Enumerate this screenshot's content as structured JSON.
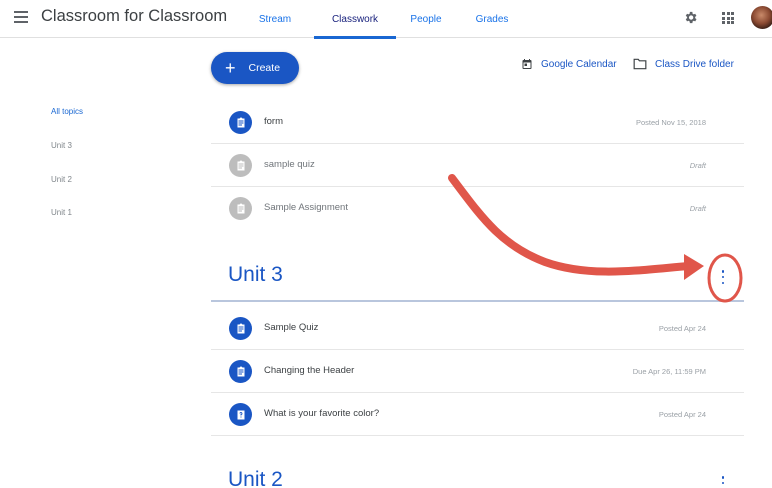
{
  "header": {
    "app_title": "Classroom for Classroom",
    "tabs": [
      {
        "label": "Stream"
      },
      {
        "label": "Classwork"
      },
      {
        "label": "People"
      },
      {
        "label": "Grades"
      }
    ],
    "active_tab": "Classwork",
    "icons": [
      "menu-icon",
      "gear-icon",
      "apps-grid-icon",
      "avatar"
    ]
  },
  "toolbar": {
    "create_label": "Create",
    "calendar_label": "Google Calendar",
    "drive_label": "Class Drive folder"
  },
  "sidebar": {
    "topics": [
      {
        "label": "All topics"
      },
      {
        "label": "Unit 3"
      },
      {
        "label": "Unit 2"
      },
      {
        "label": "Unit 1"
      }
    ]
  },
  "items": [
    {
      "title": "form",
      "meta": "Posted Nov 15, 2018",
      "icon": "assignment-icon"
    },
    {
      "title": "sample quiz",
      "meta": "Draft",
      "icon": "assignment-icon"
    },
    {
      "title": "Sample Assignment",
      "meta": "Draft",
      "icon": "assignment-icon"
    }
  ],
  "sections": [
    {
      "title": "Unit 3",
      "items": [
        {
          "title": "Sample Quiz",
          "meta": "Posted Apr 24",
          "icon": "assignment-icon"
        },
        {
          "title": "Changing the Header",
          "meta": "Due Apr 26, 11:59 PM",
          "icon": "assignment-icon"
        },
        {
          "title": "What is your favorite color?",
          "meta": "Posted Apr 24",
          "icon": "question-icon"
        }
      ]
    },
    {
      "title": "Unit 2",
      "items": []
    }
  ],
  "colors": {
    "accent": "#1a56c4",
    "annotation": "#e0564a"
  }
}
